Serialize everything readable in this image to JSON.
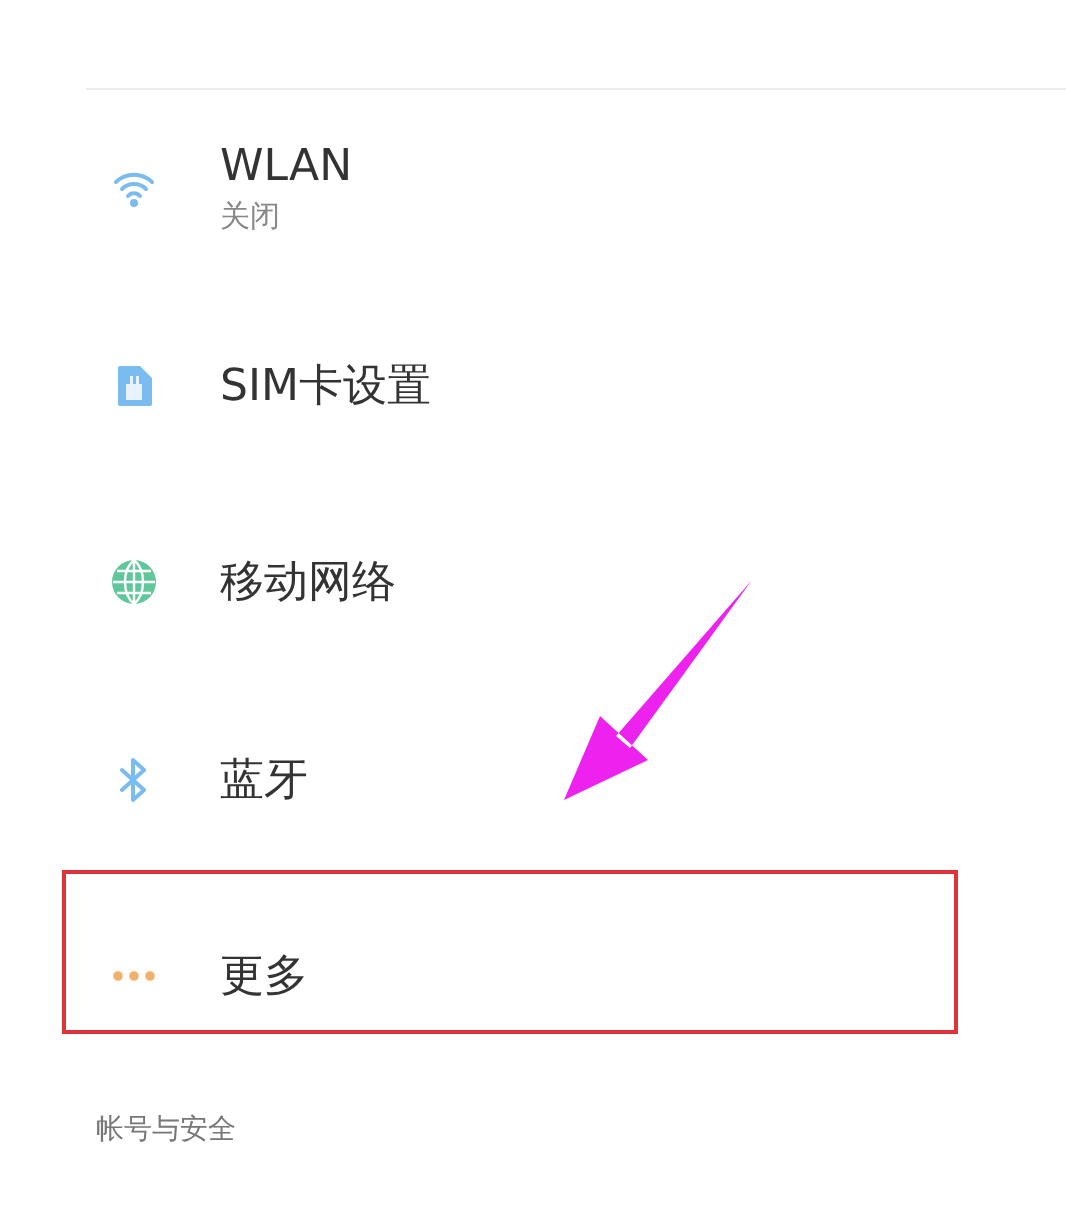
{
  "items": [
    {
      "kind": "wifi",
      "title": "WLAN",
      "subtitle": "关闭",
      "highlighted": false
    },
    {
      "kind": "sim",
      "title": "SIM卡设置",
      "highlighted": false
    },
    {
      "kind": "globe",
      "title": "移动网络",
      "highlighted": false
    },
    {
      "kind": "bluetooth",
      "title": "蓝牙",
      "highlighted": false
    },
    {
      "kind": "more",
      "title": "更多",
      "highlighted": true
    }
  ],
  "section_header": "帐号与安全"
}
